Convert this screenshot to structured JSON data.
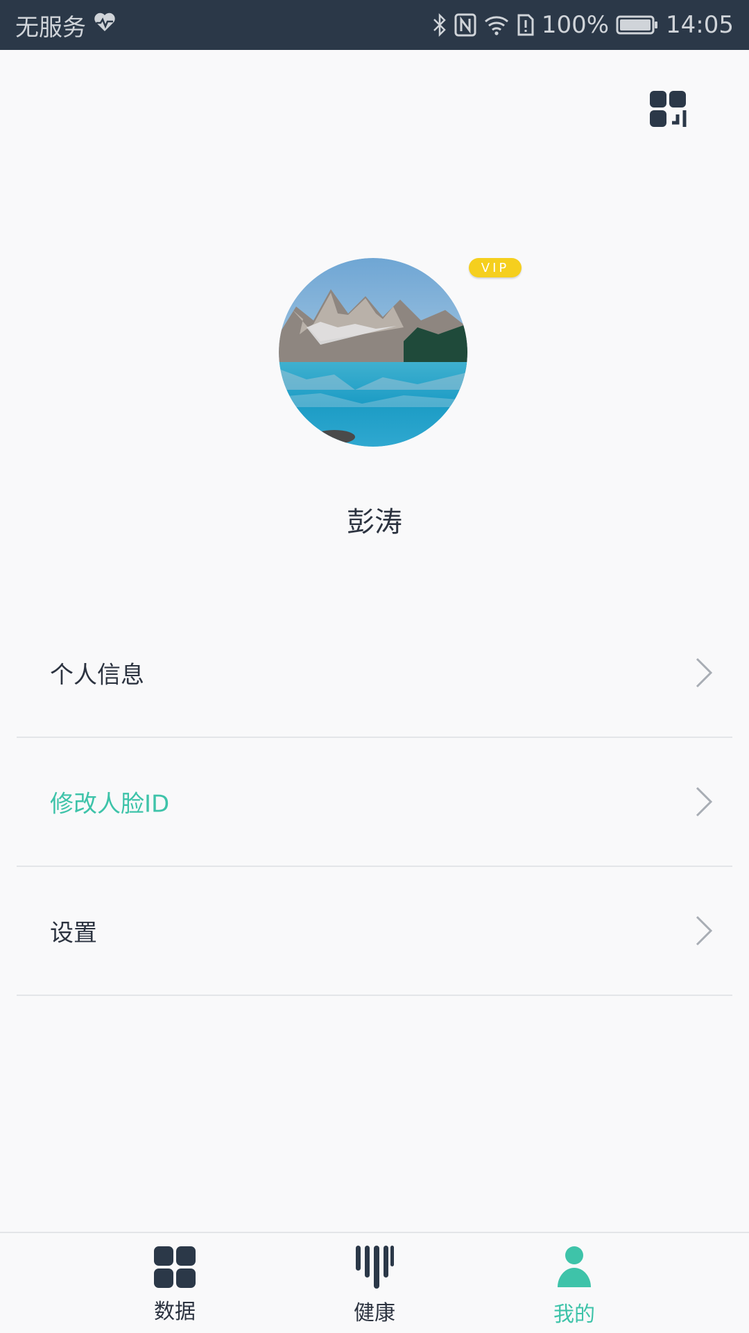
{
  "status_bar": {
    "carrier": "无服务",
    "battery": "100%",
    "time": "14:05",
    "icons": [
      "heart-pulse-icon",
      "bluetooth-icon",
      "nfc-icon",
      "wifi-icon",
      "sim-alert-icon",
      "battery-icon"
    ]
  },
  "header": {
    "qr_icon": "qr-code-icon"
  },
  "profile": {
    "vip_label": "VIP",
    "name": "彭涛",
    "avatar": "mountain-lake-photo"
  },
  "menu": [
    {
      "label": "个人信息",
      "accent": false
    },
    {
      "label": "修改人脸ID",
      "accent": true
    },
    {
      "label": "设置",
      "accent": false
    }
  ],
  "bottom_nav": [
    {
      "label": "数据",
      "icon": "grid-icon",
      "active": false
    },
    {
      "label": "健康",
      "icon": "bars-icon",
      "active": false
    },
    {
      "label": "我的",
      "icon": "person-icon",
      "active": true
    }
  ],
  "colors": {
    "accent": "#3ec3a9",
    "dark": "#2b3848",
    "vip": "#f5cf1e"
  }
}
